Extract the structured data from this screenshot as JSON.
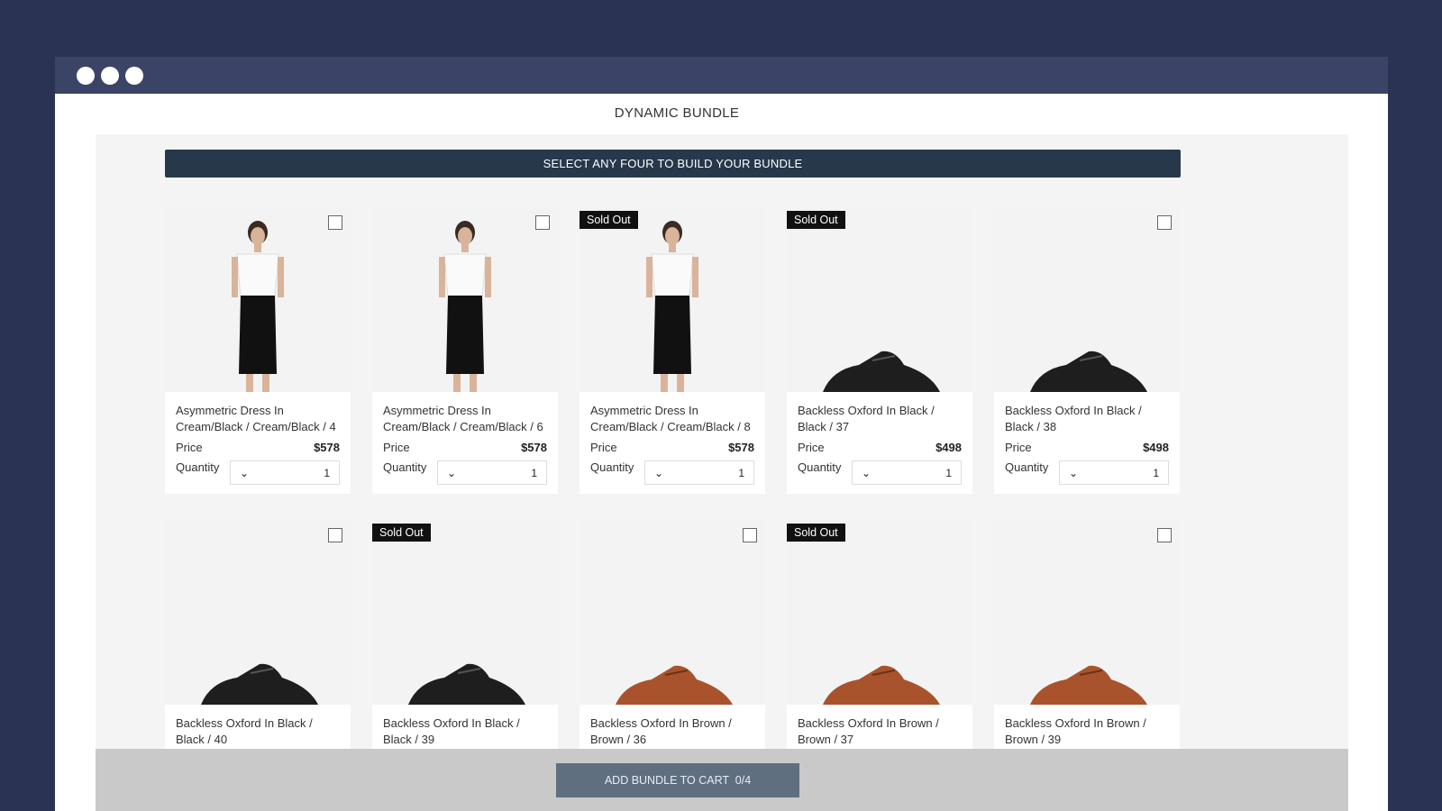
{
  "window": {
    "title": "DYNAMIC BUNDLE"
  },
  "banner": "SELECT ANY FOUR TO BUILD YOUR BUNDLE",
  "labels": {
    "price": "Price",
    "quantity": "Quantity",
    "sold_out": "Sold Out"
  },
  "products": [
    {
      "name": "Asymmetric Dress In Cream/Black / Cream/Black / 4",
      "price": "$578",
      "qty": "1",
      "sold_out": false,
      "image": "dress"
    },
    {
      "name": "Asymmetric Dress In Cream/Black / Cream/Black / 6",
      "price": "$578",
      "qty": "1",
      "sold_out": false,
      "image": "dress"
    },
    {
      "name": "Asymmetric Dress In Cream/Black / Cream/Black / 8",
      "price": "$578",
      "qty": "1",
      "sold_out": true,
      "image": "dress"
    },
    {
      "name": "Backless Oxford In Black / Black / 37",
      "price": "$498",
      "qty": "1",
      "sold_out": true,
      "image": "shoe-black"
    },
    {
      "name": "Backless Oxford In Black / Black / 38",
      "price": "$498",
      "qty": "1",
      "sold_out": false,
      "image": "shoe-black"
    },
    {
      "name": "Backless Oxford In Black / Black / 40",
      "sold_out": false,
      "image": "shoe-black"
    },
    {
      "name": "Backless Oxford In Black / Black / 39",
      "sold_out": true,
      "image": "shoe-black"
    },
    {
      "name": "Backless Oxford In Brown / Brown / 36",
      "sold_out": false,
      "image": "shoe-brown"
    },
    {
      "name": "Backless Oxford In Brown / Brown / 37",
      "sold_out": true,
      "image": "shoe-brown"
    },
    {
      "name": "Backless Oxford In Brown / Brown / 39",
      "sold_out": false,
      "image": "shoe-brown"
    }
  ],
  "footer": {
    "add_button": "ADD BUNDLE TO CART  0/4"
  },
  "colors": {
    "background": "#2b3354",
    "titlebar": "#3b4466",
    "banner": "#26384a",
    "button": "#5f6f80"
  }
}
